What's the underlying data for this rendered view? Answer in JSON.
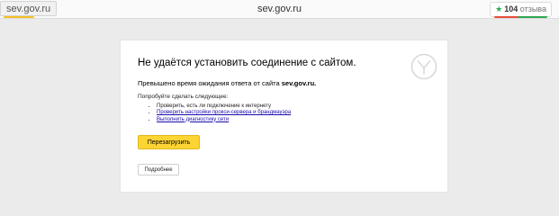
{
  "browser": {
    "site_chip": "sev.gov.ru",
    "url_title": "sev.gov.ru",
    "reviews": {
      "star": "★",
      "count": "104",
      "label": "отзыва"
    },
    "accent_color": "#f5c023"
  },
  "error_page": {
    "title": "Не удаётся установить соединение с сайтом.",
    "timeout_text": "Превышено время ожидания ответа от сайта",
    "timeout_host": "sev.gov.ru.",
    "try_heading": "Попробуйте сделать следующее:",
    "tips": [
      "Проверить, есть ли подключение к интернету",
      "Проверить настройки прокси-сервера и брандмауэра",
      "Выполнить диагностику сети"
    ],
    "reload_label": "Перезагрузить",
    "details_label": "Подробнее",
    "logo_icon": "yandex-browser-icon",
    "button_color": "#fcd433"
  }
}
